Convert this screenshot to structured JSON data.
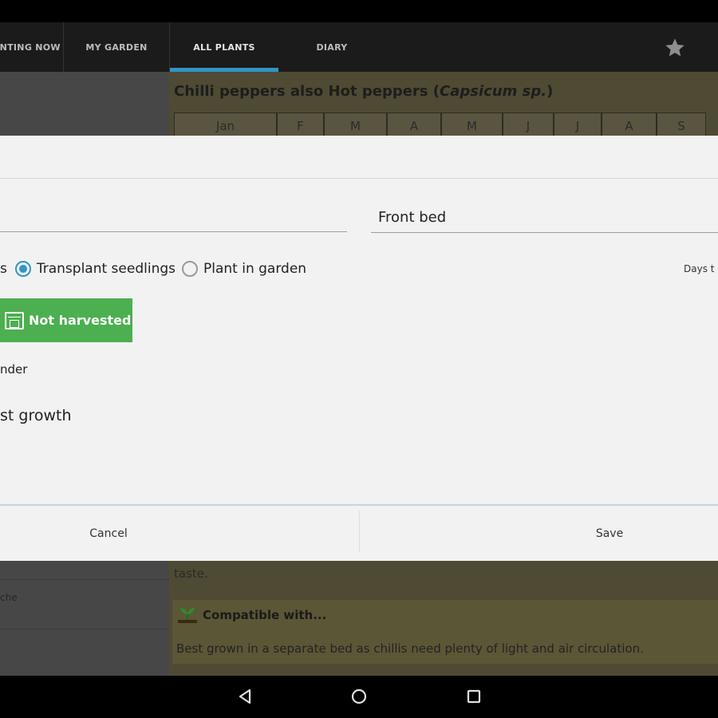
{
  "tabs": [
    {
      "label": "Planting Now"
    },
    {
      "label": "My Garden"
    },
    {
      "label": "All Plants"
    },
    {
      "label": "Diary"
    }
  ],
  "background": {
    "title_main": "Chilli peppers also Hot peppers (",
    "title_italic": "Capsicum sp.",
    "title_end": ")",
    "months": [
      "Jan",
      "F",
      "M",
      "A",
      "M",
      "J",
      "J",
      "A",
      "S"
    ],
    "taste_text": "taste.",
    "compat_heading": "Compatible with...",
    "compat_text": "Best grown in a separate bed as chillis need plenty of light and air circulation.",
    "left_item": "che"
  },
  "dialog": {
    "location_value": "Front bed",
    "radio_partial_label": "s",
    "radio_transplant_label": "Transplant seedlings",
    "radio_plant_label": "Plant in garden",
    "radio_selected": "Transplant seedlings",
    "days_label": "Days t",
    "harvest_button_label": "Not harvested",
    "reminder_text": "nder",
    "growth_text": "st growth",
    "cancel_label": "Cancel",
    "save_label": "Save"
  },
  "colors": {
    "accent": "#2f95c7",
    "harvest_green": "#4caf50",
    "action_bar": "#1b1b1b"
  },
  "icons": [
    "star-icon",
    "calendar-icon",
    "seedling-icon",
    "back-icon",
    "home-icon",
    "recents-icon"
  ]
}
